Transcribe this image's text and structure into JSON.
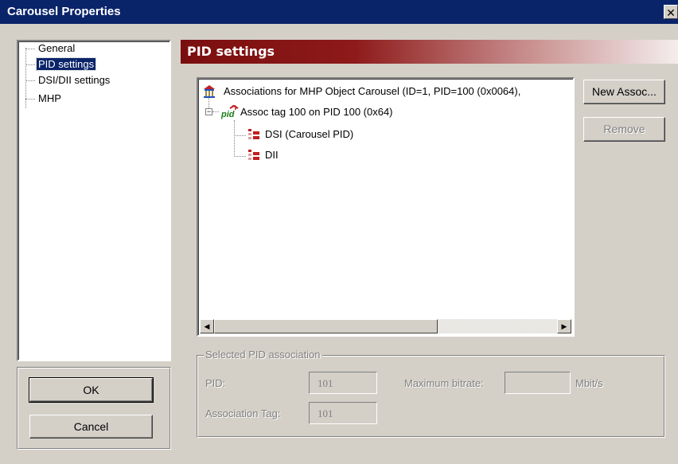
{
  "window": {
    "title": "Carousel Properties",
    "close_glyph": "✕"
  },
  "nav": {
    "items": [
      {
        "label": "General"
      },
      {
        "label": "PID settings",
        "selected": true
      },
      {
        "label": "DSI/DII settings"
      },
      {
        "label": "MHP"
      }
    ]
  },
  "buttons": {
    "ok": "OK",
    "cancel": "Cancel",
    "new_assoc": "New Assoc...",
    "remove": "Remove"
  },
  "panel": {
    "title": "PID settings"
  },
  "tree": {
    "root": {
      "label": "Associations for MHP Object Carousel (ID=1, PID=100 (0x0064),",
      "icon": "carousel-icon"
    },
    "assoc": {
      "label": "Assoc tag 100 on PID 100 (0x64)",
      "icon": "pid-icon",
      "expander": "−"
    },
    "children": [
      {
        "label": "DSI (Carousel PID)",
        "icon": "table-icon"
      },
      {
        "label": "DII",
        "icon": "table-icon"
      }
    ]
  },
  "scrollbar": {
    "left_arrow": "◀",
    "right_arrow": "▶"
  },
  "selected_association": {
    "legend": "Selected PID association",
    "pid_label": "PID:",
    "pid_value": "101",
    "max_bitrate_label": "Maximum bitrate:",
    "max_bitrate_value": "",
    "unit": "Mbit/s",
    "assoc_tag_label": "Association Tag:",
    "assoc_tag_value": "101"
  },
  "colors": {
    "title_bar": "#0a246a",
    "banner": "#8e1a1a",
    "face": "#d4d0c8"
  }
}
